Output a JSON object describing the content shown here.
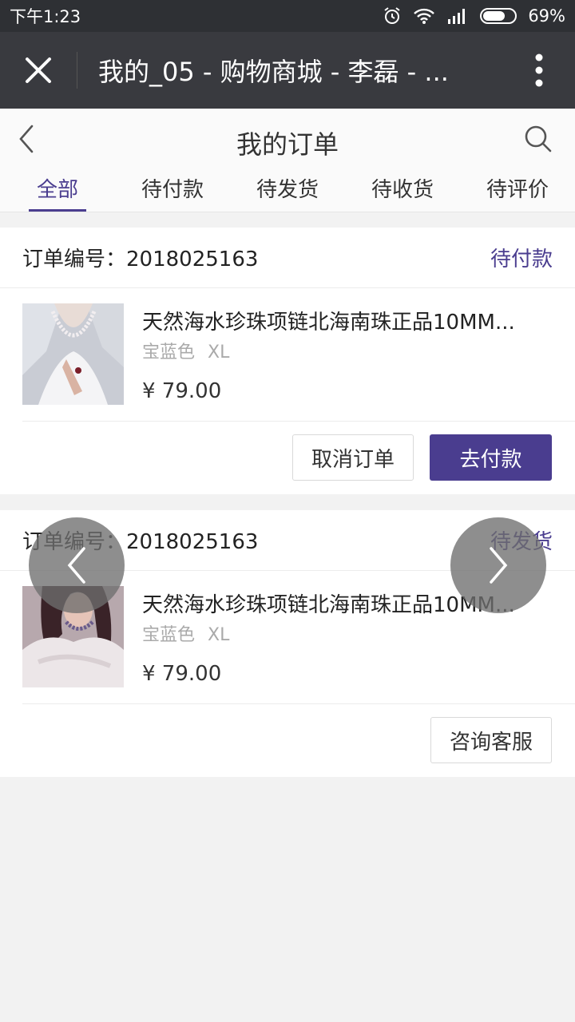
{
  "status_bar": {
    "time": "下午1:23",
    "battery": "69%",
    "battery_level": 0.69
  },
  "window": {
    "title": "我的_05 - 购物商城 - 李磊 - ...",
    "close_icon": "close-icon",
    "more_icon": "more-vertical-icon"
  },
  "header": {
    "title": "我的订单",
    "back_icon": "chevron-left-icon",
    "search_icon": "search-icon"
  },
  "tabs": [
    {
      "label": "全部",
      "active": true
    },
    {
      "label": "待付款",
      "active": false
    },
    {
      "label": "待发货",
      "active": false
    },
    {
      "label": "待收货",
      "active": false
    },
    {
      "label": "待评价",
      "active": false
    }
  ],
  "orders": [
    {
      "order_label": "订单编号：2018025163",
      "status": "待付款",
      "product_name": "天然海水珍珠项链北海南珠正品10MM...",
      "color": "宝蓝色",
      "size": "XL",
      "price": "¥ 79.00",
      "actions": [
        "取消订单",
        "去付款"
      ]
    },
    {
      "order_label": "订单编号：2018025163",
      "status": "待发货",
      "product_name": "天然海水珍珠项链北海南珠正品10MM...",
      "color": "宝蓝色",
      "size": "XL",
      "price": "¥ 79.00",
      "actions": [
        "咨询客服"
      ]
    }
  ],
  "colors": {
    "accent": "#4a3d8f",
    "title_bar": "#393a3f",
    "status_bar": "#2e3034",
    "background": "#f2f2f2"
  }
}
